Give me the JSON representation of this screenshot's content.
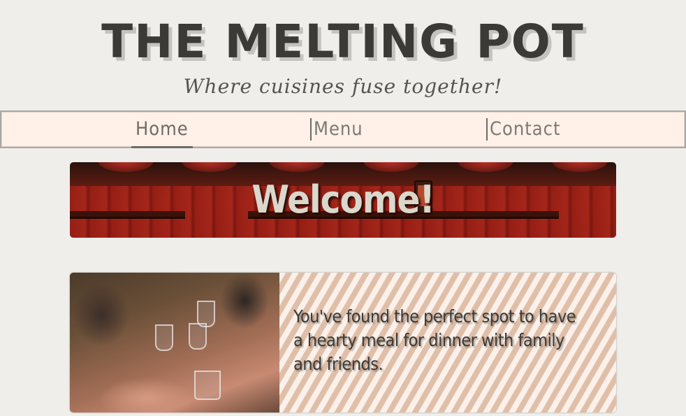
{
  "header": {
    "title": "THE MELTING POT",
    "tagline": "Where cuisines fuse together!"
  },
  "nav": {
    "items": [
      {
        "label": "Home",
        "active": true
      },
      {
        "label": "Menu",
        "active": false
      },
      {
        "label": "Contact",
        "active": false
      }
    ]
  },
  "banner": {
    "text": "Welcome!"
  },
  "feature": {
    "text": "You've found the perfect spot to have a hearty meal for dinner with family and friends."
  },
  "colors": {
    "background": "#efeeeb",
    "nav_background": "#fff1e8",
    "text_dark": "#3b3a37",
    "banner_red": "#8a1d14",
    "stripe_tan": "#e0bfa9"
  }
}
